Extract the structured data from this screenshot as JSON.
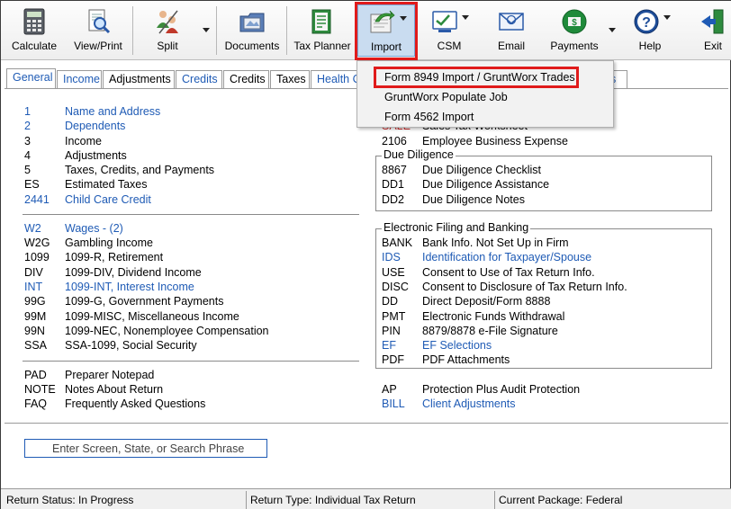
{
  "toolbar": {
    "calculate": "Calculate",
    "view_print": "View/Print",
    "split": "Split",
    "documents": "Documents",
    "tax_planner": "Tax Planner",
    "import": "Import",
    "csm": "CSM",
    "email": "Email",
    "payments": "Payments",
    "help": "Help",
    "exit": "Exit"
  },
  "tabs": [
    "General",
    "Income",
    "Adjustments",
    "Credits",
    "Credits",
    "Taxes",
    "Health C"
  ],
  "tab_fragment_right": "es",
  "import_menu": {
    "items": [
      "Form 8949 Import / GruntWorx Trades",
      "GruntWorx Populate Job",
      "Form 4562 Import"
    ]
  },
  "left_list": {
    "group1": [
      {
        "code": "1",
        "desc": "Name and Address",
        "link": true
      },
      {
        "code": "2",
        "desc": "Dependents",
        "link": true
      },
      {
        "code": "3",
        "desc": "Income",
        "link": false
      },
      {
        "code": "4",
        "desc": "Adjustments",
        "link": false
      },
      {
        "code": "5",
        "desc": "Taxes, Credits, and Payments",
        "link": false
      },
      {
        "code": "ES",
        "desc": "Estimated Taxes",
        "link": false
      },
      {
        "code": "2441",
        "desc": "Child Care Credit",
        "link": true
      }
    ],
    "group2": [
      {
        "code": "W2",
        "desc": "Wages - (2)",
        "link": true
      },
      {
        "code": "W2G",
        "desc": "Gambling Income",
        "link": false
      },
      {
        "code": "1099",
        "desc": "1099-R, Retirement",
        "link": false
      },
      {
        "code": "DIV",
        "desc": "1099-DIV, Dividend Income",
        "link": false
      },
      {
        "code": "INT",
        "desc": "1099-INT, Interest Income",
        "link": true
      },
      {
        "code": "99G",
        "desc": "1099-G, Government Payments",
        "link": false
      },
      {
        "code": "99M",
        "desc": "1099-MISC, Miscellaneous Income",
        "link": false
      },
      {
        "code": "99N",
        "desc": "1099-NEC, Nonemployee Compensation",
        "link": false
      },
      {
        "code": "SSA",
        "desc": "SSA-1099, Social Security",
        "link": false
      }
    ],
    "group3": [
      {
        "code": "PAD",
        "desc": "Preparer Notepad",
        "link": false
      },
      {
        "code": "NOTE",
        "desc": "Notes About Return",
        "link": false
      },
      {
        "code": "FAQ",
        "desc": "Frequently Asked Questions",
        "link": false
      }
    ]
  },
  "right_list": {
    "partial_row": {
      "code": "SALE",
      "desc": "Sales Tax Worksheet"
    },
    "row_2106": {
      "code": "2106",
      "desc": "Employee Business Expense"
    },
    "due_diligence": {
      "title": "Due Diligence",
      "items": [
        {
          "code": "8867",
          "desc": "Due Diligence Checklist",
          "link": false
        },
        {
          "code": "DD1",
          "desc": "Due Diligence Assistance",
          "link": false
        },
        {
          "code": "DD2",
          "desc": "Due Diligence Notes",
          "link": false
        }
      ]
    },
    "efiling": {
      "title": "Electronic Filing and Banking",
      "items": [
        {
          "code": "BANK",
          "desc": "Bank Info. Not Set Up in Firm",
          "link": false
        },
        {
          "code": "IDS",
          "desc": "Identification for Taxpayer/Spouse",
          "link": true
        },
        {
          "code": "USE",
          "desc": "Consent to Use of Tax Return Info.",
          "link": false
        },
        {
          "code": "DISC",
          "desc": "Consent to Disclosure of Tax Return Info.",
          "link": false
        },
        {
          "code": "DD",
          "desc": "Direct Deposit/Form 8888",
          "link": false
        },
        {
          "code": "PMT",
          "desc": "Electronic Funds Withdrawal",
          "link": false
        },
        {
          "code": "PIN",
          "desc": "8879/8878 e-File Signature",
          "link": false
        },
        {
          "code": "EF",
          "desc": "EF Selections",
          "link": true
        },
        {
          "code": "PDF",
          "desc": "PDF Attachments",
          "link": false
        }
      ]
    },
    "bottom": [
      {
        "code": "AP",
        "desc": "Protection Plus Audit Protection",
        "link": false
      },
      {
        "code": "BILL",
        "desc": "Client Adjustments",
        "link": true
      }
    ]
  },
  "search": {
    "placeholder": "Enter Screen, State, or Search Phrase"
  },
  "status": {
    "return_status": "Return Status: In Progress",
    "return_type": "Return Type: Individual Tax Return",
    "package": "Current Package: Federal"
  },
  "colors": {
    "link": "#1f5bb5",
    "highlight_border": "#e01b1b",
    "selected_button": "#c9dcf0"
  }
}
